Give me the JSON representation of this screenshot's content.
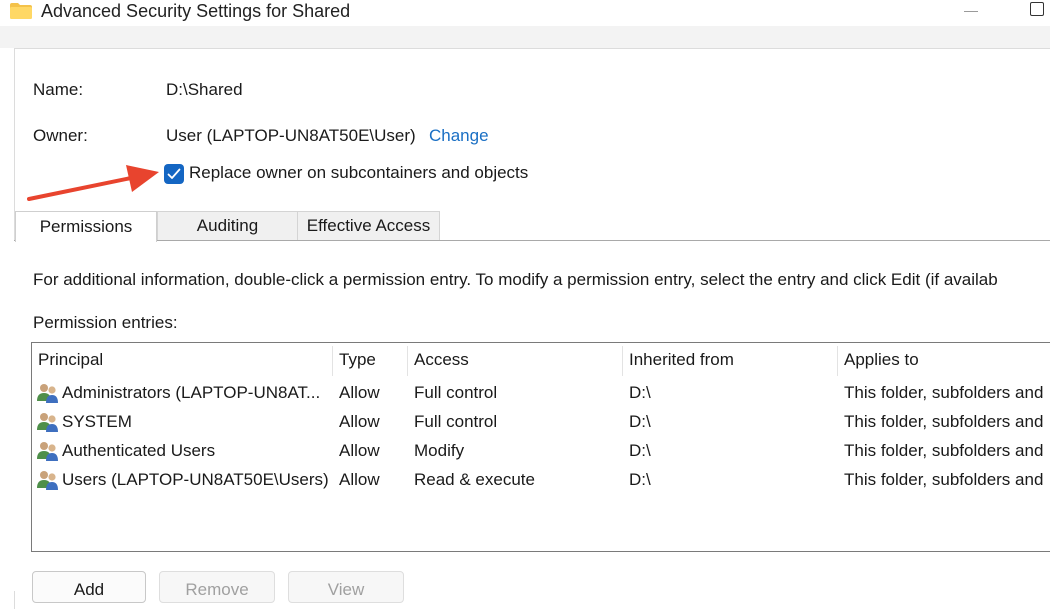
{
  "window": {
    "title": "Advanced Security Settings for Shared"
  },
  "name_row": {
    "label": "Name:",
    "value": "D:\\Shared"
  },
  "owner_row": {
    "label": "Owner:",
    "value": "User (LAPTOP-UN8AT50E\\User)",
    "change_link": "Change"
  },
  "replace_owner": {
    "label": "Replace owner on subcontainers and objects",
    "checked": true
  },
  "tabs": [
    {
      "label": "Permissions",
      "active": true
    },
    {
      "label": "Auditing",
      "active": false
    },
    {
      "label": "Effective Access",
      "active": false
    }
  ],
  "permissions": {
    "info_text": "For additional information, double-click a permission entry. To modify a permission entry, select the entry and click Edit (if availab",
    "entries_label": "Permission entries:",
    "columns": [
      "Principal",
      "Type",
      "Access",
      "Inherited from",
      "Applies to"
    ],
    "rows": [
      {
        "principal": "Administrators (LAPTOP-UN8AT...",
        "type": "Allow",
        "access": "Full control",
        "inherited": "D:\\",
        "applies": "This folder, subfolders and"
      },
      {
        "principal": "SYSTEM",
        "type": "Allow",
        "access": "Full control",
        "inherited": "D:\\",
        "applies": "This folder, subfolders and"
      },
      {
        "principal": "Authenticated Users",
        "type": "Allow",
        "access": "Modify",
        "inherited": "D:\\",
        "applies": "This folder, subfolders and"
      },
      {
        "principal": "Users (LAPTOP-UN8AT50E\\Users)",
        "type": "Allow",
        "access": "Read & execute",
        "inherited": "D:\\",
        "applies": "This folder, subfolders and"
      }
    ]
  },
  "buttons": {
    "add": "Add",
    "remove": "Remove",
    "view": "View"
  },
  "colors": {
    "accent": "#1466c3",
    "link": "#1a6fc4",
    "arrow": "#e8442e"
  }
}
